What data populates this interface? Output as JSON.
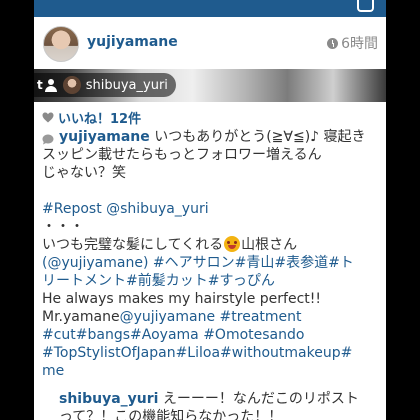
{
  "post": {
    "username": "yujiyamane",
    "time": "6時間",
    "tag": {
      "tag_icon_text": "t",
      "user": "shibuya_yuri"
    },
    "likes": "いいね！12件",
    "caption": {
      "owner": "yujiyamane",
      "line1": " いつもありがとう(≧∀≦)♪ 寝起き",
      "line2": "スッピン載せたらもっとフォロワー増えるん",
      "line3": "じゃない？笑",
      "repost": "#Repost @shibuya_yuri",
      "dots": "・・・",
      "line4a": "いつも完璧な髪にしてくれる",
      "line4b": "山根さん",
      "line5a": "(@yujiyamane) ",
      "line5b": "#ヘアサロン#青山#表参道#ト",
      "line6": "リートメント#前髪カット#すっぴん",
      "line7": "He always makes my hairstyle perfect!!",
      "line8a": "Mr.yamane",
      "line8b": "@yujiyamane #treatment",
      "line9": "#cut#bangs#Aoyama #Omotesando",
      "line10": "#TopStylistOfJapan#Liloa#withoutmakeup#",
      "line11": "me"
    },
    "comment": {
      "user": "shibuya_yuri",
      "text1": " えーーー！なんだこのリポスト",
      "text2": "って？！この機能知らなかった！！"
    }
  },
  "colors": {
    "brand": "#1f5b8e",
    "text": "#333333",
    "muted": "#8a8a8a"
  },
  "icons": [
    "camera-icon",
    "clock-icon",
    "tag-icon",
    "heart-icon",
    "comment-icon",
    "emoji-icon"
  ]
}
